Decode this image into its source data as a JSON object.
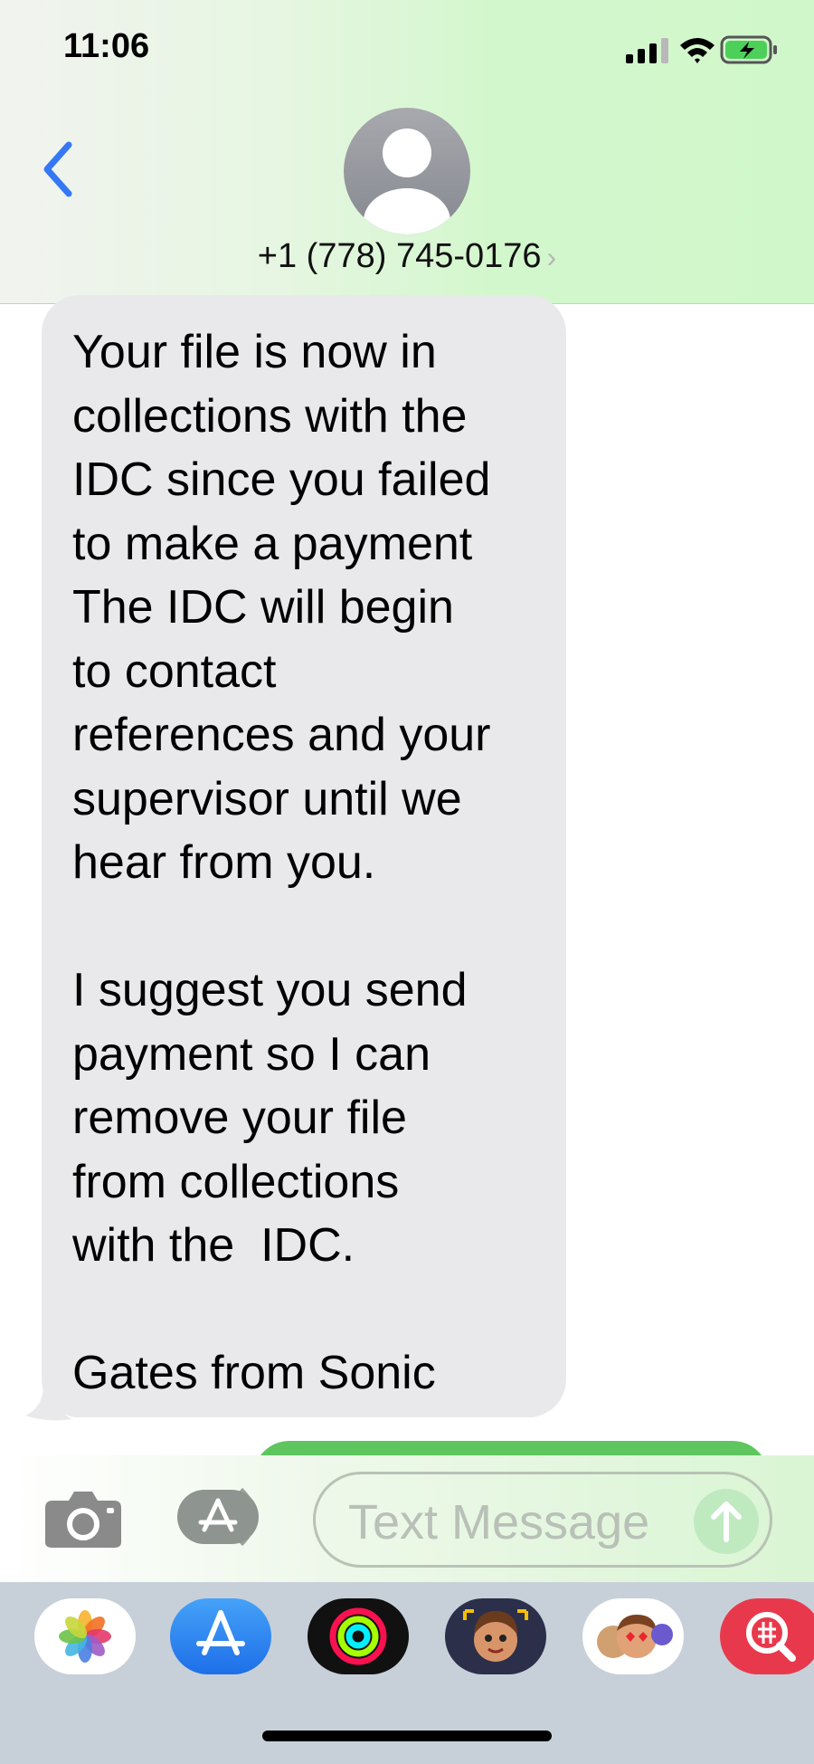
{
  "status_bar": {
    "time": "11:06"
  },
  "header": {
    "back_icon": "chevron-left-icon",
    "avatar_icon": "person-icon",
    "contact": "+1 (778) 745-0176",
    "contact_chevron": "›"
  },
  "conversation": {
    "messages": [
      {
        "direction": "incoming",
        "text": "Your file is now in\ncollections with the\nIDC since you failed\nto make a payment\nThe IDC will begin\nto contact\nreferences and your\nsupervisor until we\nhear from you.\n\nI suggest you send\npayment so I can\nremove your file\nfrom collections\nwith the  IDC.\n\nGates from Sonic"
      }
    ]
  },
  "input": {
    "placeholder": "Text Message",
    "camera_icon": "camera-icon",
    "apps_icon": "app-store-icon",
    "send_icon": "arrow-up-icon"
  },
  "drawer": {
    "apps": [
      "photos-icon",
      "app-store-icon",
      "activity-icon",
      "memoji-icon",
      "memoji-stickers-icon",
      "images-search-icon"
    ]
  },
  "colors": {
    "accent": "#3478f6",
    "incoming_bubble": "#e9e9eb",
    "outgoing_bubble": "#5ec55f"
  }
}
